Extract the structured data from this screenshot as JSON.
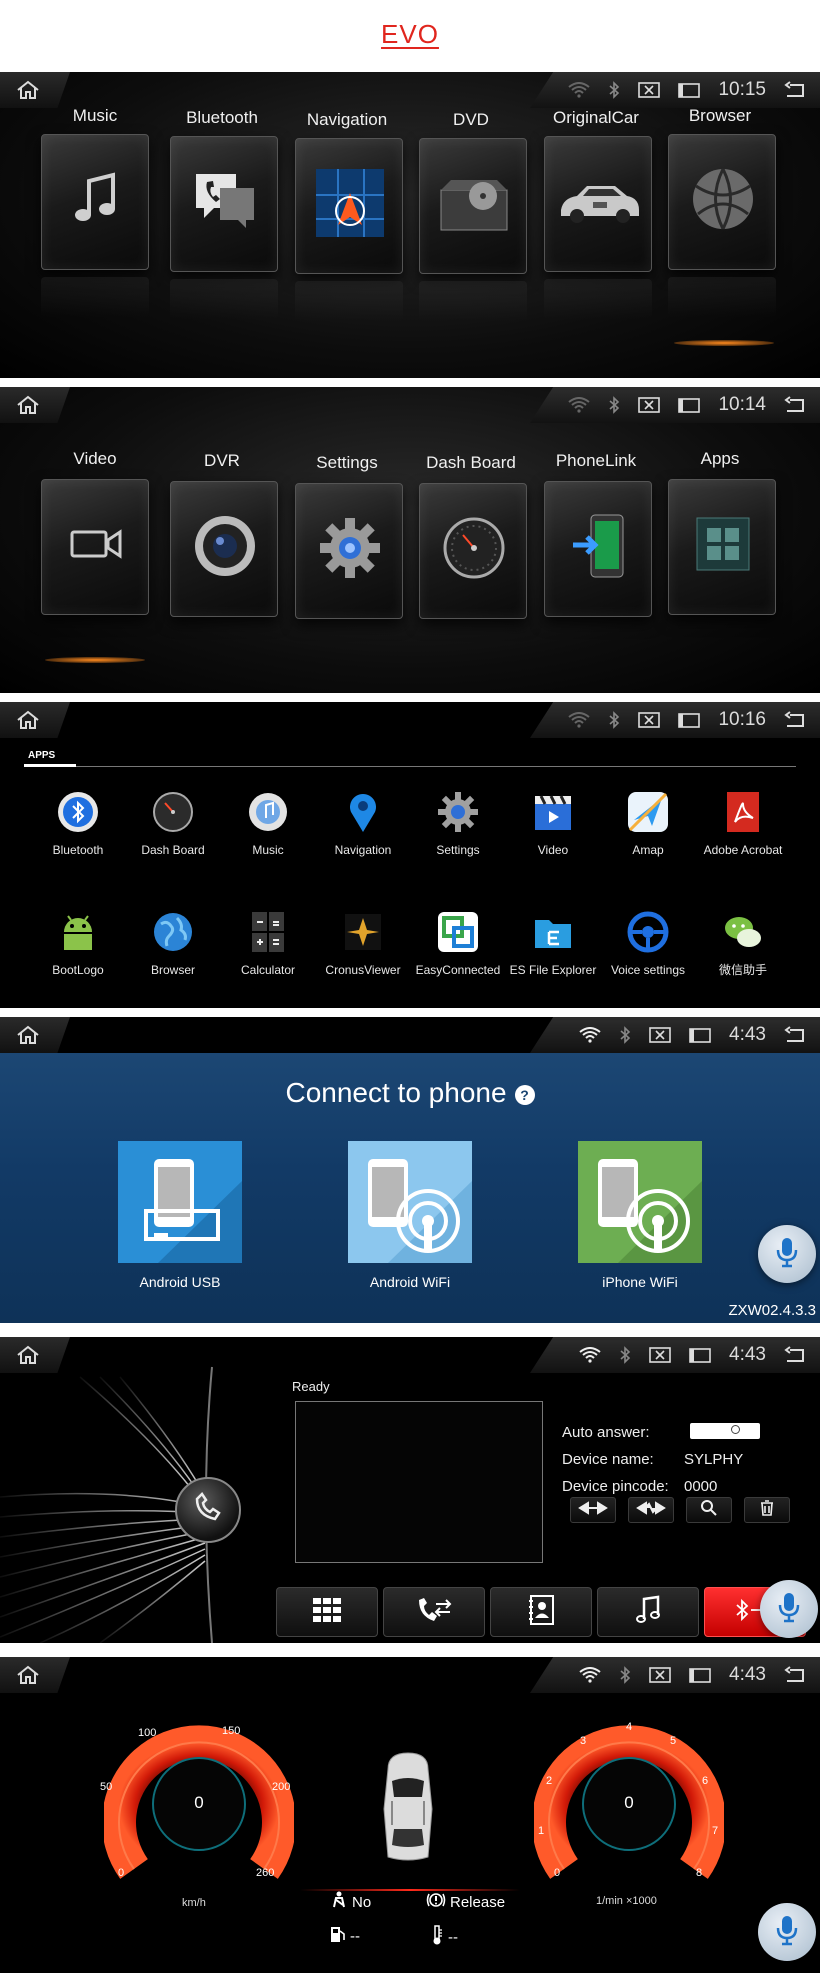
{
  "brand": "EVO",
  "status_bars": [
    {
      "time": "10:15"
    },
    {
      "time": "10:14"
    },
    {
      "time": "10:16"
    },
    {
      "time": "4:43"
    },
    {
      "time": "4:43"
    },
    {
      "time": "4:43"
    }
  ],
  "launcher1": {
    "tiles": [
      {
        "label": "Music",
        "icon": "music-note-icon"
      },
      {
        "label": "Bluetooth",
        "icon": "phone-chat-icon"
      },
      {
        "label": "Navigation",
        "icon": "navigation-map-icon"
      },
      {
        "label": "DVD",
        "icon": "dvd-drive-icon"
      },
      {
        "label": "OriginalCar",
        "icon": "car-icon"
      },
      {
        "label": "Browser",
        "icon": "globe-icon"
      }
    ]
  },
  "launcher2": {
    "tiles": [
      {
        "label": "Video",
        "icon": "video-camera-icon"
      },
      {
        "label": "DVR",
        "icon": "camera-lens-icon"
      },
      {
        "label": "Settings",
        "icon": "gear-icon"
      },
      {
        "label": "Dash Board",
        "icon": "speedometer-icon"
      },
      {
        "label": "PhoneLink",
        "icon": "phone-link-icon"
      },
      {
        "label": "Apps",
        "icon": "apps-grid-icon"
      }
    ]
  },
  "app_grid": {
    "tab_label": "APPS",
    "apps": [
      {
        "label": "Bluetooth"
      },
      {
        "label": "Dash Board"
      },
      {
        "label": "Music"
      },
      {
        "label": "Navigation"
      },
      {
        "label": "Settings"
      },
      {
        "label": "Video"
      },
      {
        "label": "Amap"
      },
      {
        "label": "Adobe Acrobat"
      },
      {
        "label": "BootLogo"
      },
      {
        "label": "Browser"
      },
      {
        "label": "Calculator"
      },
      {
        "label": "CronusViewer"
      },
      {
        "label": "EasyConnected"
      },
      {
        "label": "ES File Explorer"
      },
      {
        "label": "Voice settings"
      },
      {
        "label": "微信助手"
      }
    ]
  },
  "connect": {
    "title": "Connect to phone",
    "help": "?",
    "options": [
      {
        "label": "Android USB",
        "color": "#2a8fd6"
      },
      {
        "label": "Android WiFi",
        "color": "#8cc7ee"
      },
      {
        "label": "iPhone WiFi",
        "color": "#6dae52"
      }
    ],
    "version": "ZXW02.4.3.3"
  },
  "bluetooth": {
    "status": "Ready",
    "auto_answer_label": "Auto answer:",
    "device_name_label": "Device name:",
    "device_name_value": "SYLPHY",
    "pincode_label": "Device pincode:",
    "pincode_value": "0000"
  },
  "dash": {
    "speed_value": "0",
    "speed_unit": "km/h",
    "speed_ticks": [
      "0",
      "50",
      "100",
      "150",
      "200",
      "260"
    ],
    "rpm_value": "0",
    "rpm_unit": "1/min ×1000",
    "rpm_ticks": [
      "0",
      "1",
      "2",
      "3",
      "4",
      "5",
      "6",
      "7",
      "8"
    ],
    "seatbelt_text": "No",
    "brake_text": "Release",
    "fuel_text": "--",
    "temp_text": "--"
  }
}
